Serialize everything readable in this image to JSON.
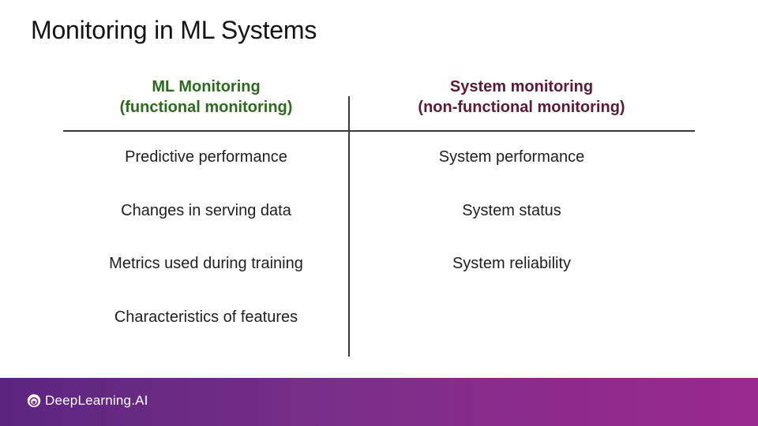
{
  "slide": {
    "title": "Monitoring in ML Systems"
  },
  "columns": {
    "ml": {
      "header_line1": "ML Monitoring",
      "header_line2": "(functional monitoring)",
      "items": [
        "Predictive performance",
        "Changes in serving data",
        "Metrics used during training",
        "Characteristics of features"
      ]
    },
    "system": {
      "header_line1": "System monitoring",
      "header_line2": "(non-functional monitoring)",
      "items": [
        "System performance",
        "System status",
        "System reliability"
      ]
    }
  },
  "colors": {
    "ml_header": "#2d6a1f",
    "system_header": "#5a1a38",
    "footer_start": "#5b2580",
    "footer_end": "#9b2a8e"
  },
  "footer": {
    "brand": "DeepLearning.AI",
    "brand_icon": "deeplearning-logo-icon"
  }
}
